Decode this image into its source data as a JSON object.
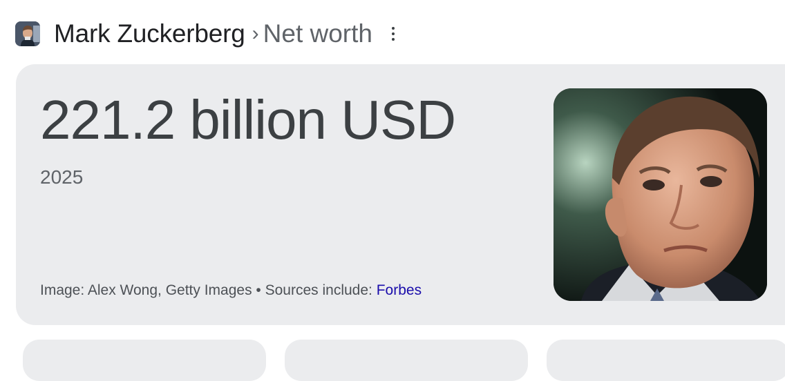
{
  "breadcrumb": {
    "entity": "Mark Zuckerberg",
    "separator": "›",
    "attribute": "Net worth"
  },
  "answer": {
    "value": "221.2 billion USD",
    "year": "2025"
  },
  "attribution": {
    "image_credit": "Image: Alex Wong, Getty Images",
    "dot": " • ",
    "sources_prefix": "Sources include: ",
    "source_link": "Forbes"
  },
  "colors": {
    "card_background": "#ebecee",
    "link": "#1a0dab",
    "primary_text": "#202124",
    "secondary_text": "#5f6368"
  },
  "icons": {
    "more": "more-vertical-icon"
  }
}
